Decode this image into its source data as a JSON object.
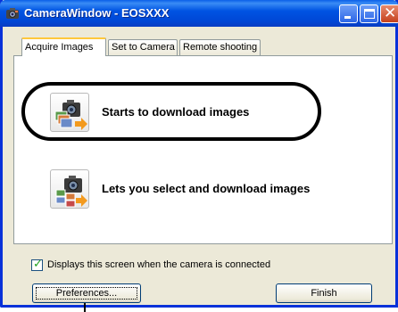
{
  "window": {
    "title": "CameraWindow - EOSXXX",
    "close_glyph": "✕"
  },
  "tabs": [
    {
      "label": "Acquire Images",
      "active": true
    },
    {
      "label": "Set to Camera",
      "active": false
    },
    {
      "label": "Remote shooting",
      "active": false
    }
  ],
  "actions": [
    {
      "label": "Starts to download images",
      "icon": "camera-download-icon",
      "highlighted": true
    },
    {
      "label": "Lets you select and download images",
      "icon": "camera-select-download-icon",
      "highlighted": false
    }
  ],
  "auto_display": {
    "label": "Displays this screen when the camera is connected",
    "checked": true,
    "mark": "✓"
  },
  "buttons": {
    "preferences": "Preferences...",
    "finish": "Finish"
  },
  "colors": {
    "titlebar": "#0054e3",
    "window_bg": "#ece9d8",
    "accent_tab": "#ffc83c",
    "arrow": "#f39a1e"
  }
}
